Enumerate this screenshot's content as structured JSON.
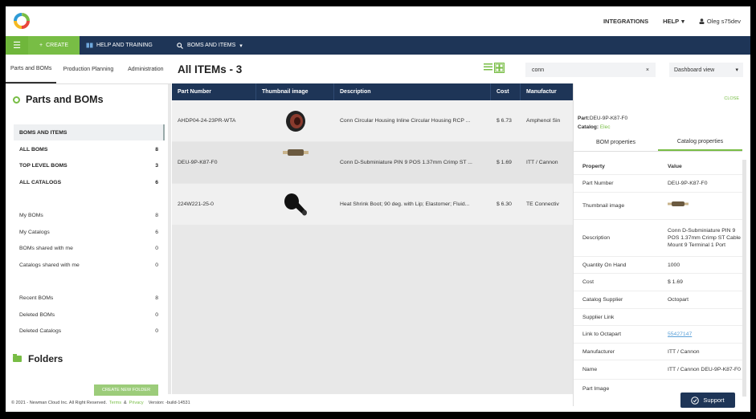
{
  "topbar": {
    "integrations": "INTEGRATIONS",
    "help": "HELP",
    "user": "Oleg s75dev"
  },
  "navbar": {
    "create": "CREATE",
    "help_training": "HELP AND TRAINING",
    "boms_items": "BOMS AND ITEMS"
  },
  "left_tabs": [
    "Parts and BOMs",
    "Production Planning",
    "Administration"
  ],
  "sidebar": {
    "title": "Parts and BOMs",
    "group1": [
      {
        "label": "BOMS AND ITEMS",
        "count": ""
      },
      {
        "label": "ALL BOMS",
        "count": "8"
      },
      {
        "label": "TOP LEVEL BOMS",
        "count": "3"
      },
      {
        "label": "ALL CATALOGS",
        "count": "6"
      }
    ],
    "group2": [
      {
        "label": "My BOMs",
        "count": "8"
      },
      {
        "label": "My Catalogs",
        "count": "6"
      },
      {
        "label": "BOMs shared with me",
        "count": "0"
      },
      {
        "label": "Catalogs shared with me",
        "count": "0"
      }
    ],
    "group3": [
      {
        "label": "Recent BOMs",
        "count": "8"
      },
      {
        "label": "Deleted BOMs",
        "count": "0"
      },
      {
        "label": "Deleted Catalogs",
        "count": "0"
      }
    ],
    "folders": "Folders",
    "create_folder": "CREATE NEW FOLDER"
  },
  "main": {
    "title": "All ITEMs - 3",
    "search_value": "conn",
    "search_clear": "×",
    "view_select": "Dashboard view"
  },
  "table": {
    "headers": [
      "Part Number",
      "Thumbnail image",
      "Description",
      "Cost",
      "Manufactur"
    ],
    "rows": [
      {
        "part": "AHDP04-24-23PR-WTA",
        "desc": "Conn Circular Housing Inline Circular Housing RCP ...",
        "cost": "$ 6.73",
        "mfr": "Amphenol Sin"
      },
      {
        "part": "DEU-9P-K87-F0",
        "desc": "Conn D-Subminiature PIN 9 POS 1.37mm Crimp ST ...",
        "cost": "$ 1.69",
        "mfr": "ITT / Cannon"
      },
      {
        "part": "224W221-25-0",
        "desc": "Heat Shrink Boot; 90 deg. with Lip; Elastomer; Fluid...",
        "cost": "$ 6.30",
        "mfr": "TE Connectiv"
      }
    ]
  },
  "panel": {
    "close": "CLOSE",
    "part_label": "Part:",
    "part_value": "DEU-9P-K87-F0",
    "catalog_label": "Catalog:",
    "catalog_value": "Elec",
    "tabs": [
      "BOM properties",
      "Catalog properties"
    ],
    "header": {
      "key": "Property",
      "value": "Value"
    },
    "rows": [
      {
        "key": "Part Number",
        "value": "DEU-9P-K87-F0"
      },
      {
        "key": "Thumbnail image",
        "value": ""
      },
      {
        "key": "Description",
        "value": "Conn D-Subminiature PIN 9 POS 1.37mm Crimp ST Cable Mount 9 Terminal 1 Port"
      },
      {
        "key": "Quantity On Hand",
        "value": "1000"
      },
      {
        "key": "Cost",
        "value": "$ 1.69"
      },
      {
        "key": "Catalog Supplier",
        "value": "Octopart"
      },
      {
        "key": "Supplier Link",
        "value": ""
      },
      {
        "key": "Link to Octapart",
        "value": "55427147"
      },
      {
        "key": "Manufacturer",
        "value": "ITT / Cannon"
      },
      {
        "key": "Name",
        "value": "ITT / Cannon DEU-9P-K87-F0"
      },
      {
        "key": "Part Image",
        "value": ""
      }
    ]
  },
  "footer": {
    "copyright": "© 2021 - Newman Cloud Inc. All Right Reserved.",
    "terms": "Terms",
    "amp": "&",
    "privacy": "Privacy",
    "version": "Version: -build-14531"
  },
  "support": "Support",
  "colors": {
    "navy": "#1e3557",
    "green": "#78bd45"
  }
}
